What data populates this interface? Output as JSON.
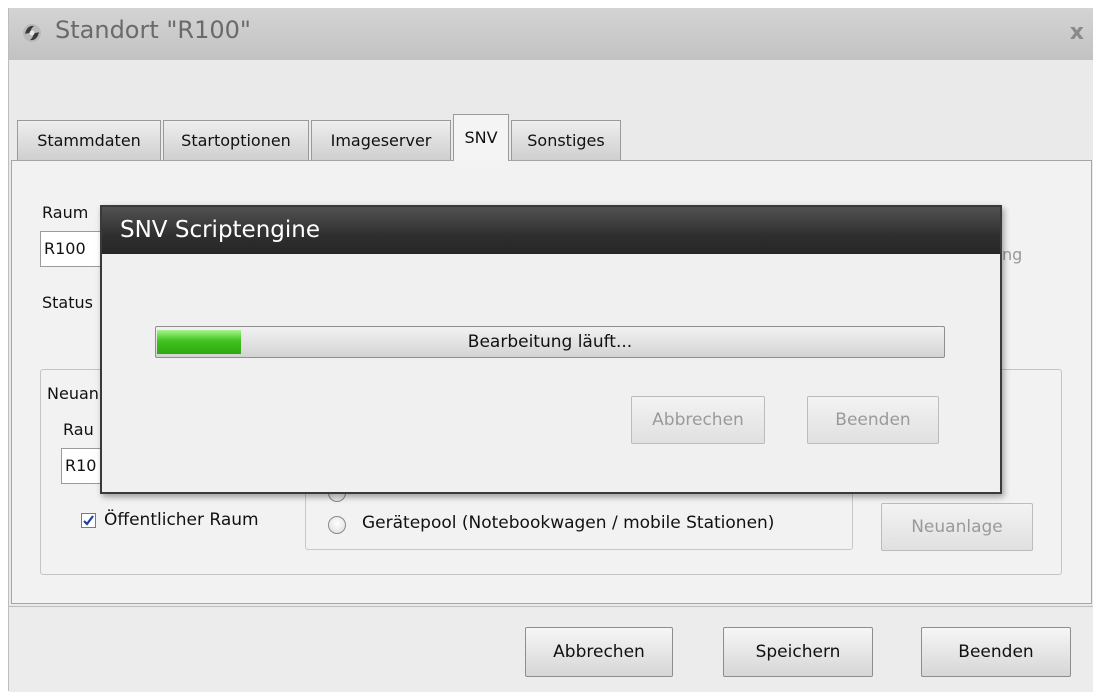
{
  "window": {
    "title": "Standort \"R100\"",
    "close_symbol": "x",
    "icon": "app-gear-icon"
  },
  "tabs": [
    {
      "label": "Stammdaten",
      "active": false
    },
    {
      "label": "Startoptionen",
      "active": false
    },
    {
      "label": "Imageserver",
      "active": false
    },
    {
      "label": "SNV",
      "active": true
    },
    {
      "label": "Sonstiges",
      "active": false
    }
  ],
  "snv_tab": {
    "raum_label": "Raum",
    "raum_value": "R100",
    "status_label": "Status",
    "right_text_fragment": "ng",
    "neuanlage_group": {
      "title": "Neuan",
      "raum_label": "Rau",
      "raum_value": "R10",
      "public_room_label": "Öffentlicher Raum",
      "public_room_checked": true,
      "device_pool_label": "Gerätepool (Notebookwagen / mobile Stationen)",
      "neuanlage_button": "Neuanlage"
    }
  },
  "footer": {
    "cancel_label": "Abbrechen",
    "save_label": "Speichern",
    "close_label": "Beenden"
  },
  "modal": {
    "title": "SNV Scriptengine",
    "progress_text": "Bearbeitung läuft...",
    "progress_fraction": 0.107,
    "cancel_label": "Abbrechen",
    "close_label": "Beenden"
  },
  "colors": {
    "progress_fill": "#42c21f",
    "modal_titlebar": "#2f2f2f",
    "window_titlebar": "#c8c8c8"
  }
}
